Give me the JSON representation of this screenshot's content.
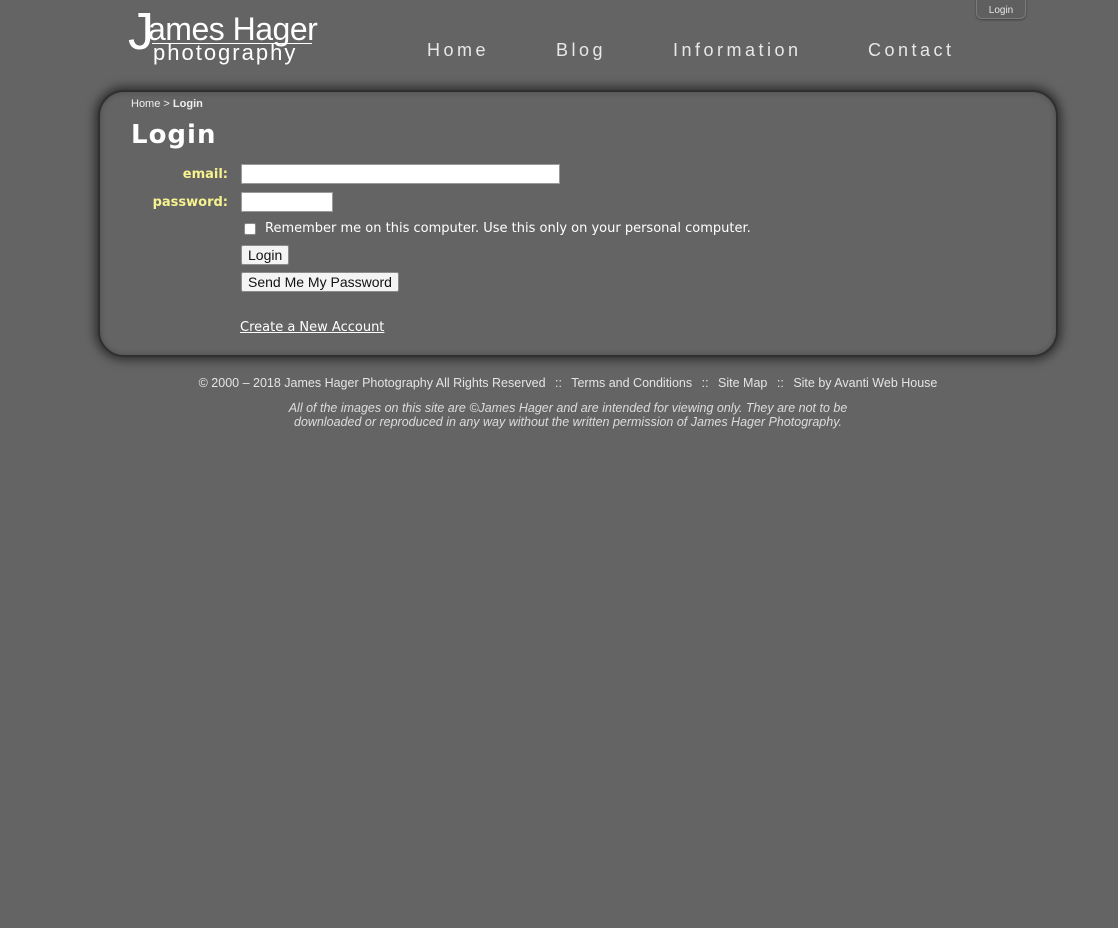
{
  "header": {
    "login_tab": "Login",
    "logo": {
      "line1": "ames Hager",
      "initial": "J",
      "line2": "photography"
    },
    "nav": [
      {
        "label": "Home"
      },
      {
        "label": "Blog"
      },
      {
        "label": "Information"
      },
      {
        "label": "Contact"
      }
    ]
  },
  "breadcrumb": {
    "home": "Home",
    "separator": ">",
    "current": "Login"
  },
  "main": {
    "title": "Login",
    "email_label": "email:",
    "email_value": "",
    "password_label": "password:",
    "password_value": "",
    "remember_checked": false,
    "remember_label": "Remember me on this computer. Use this only on your personal computer.",
    "login_button": "Login",
    "send_password_button": "Send Me My Password",
    "create_account_link": "Create a New Account"
  },
  "footer": {
    "copyright": "© 2000 – 2018 James Hager Photography All Rights Reserved",
    "separator": "::",
    "terms": "Terms and Conditions",
    "sitemap": "Site Map",
    "site_by": "Site by Avanti Web House",
    "notice": "All of the images on this site are ©James Hager and are intended for viewing only. They are not to be downloaded or reproduced in any way without the written permission of James Hager Photography."
  },
  "colors": {
    "background": "#646464",
    "label_accent": "#f6f28e",
    "panel_border": "#2f2f2f"
  }
}
